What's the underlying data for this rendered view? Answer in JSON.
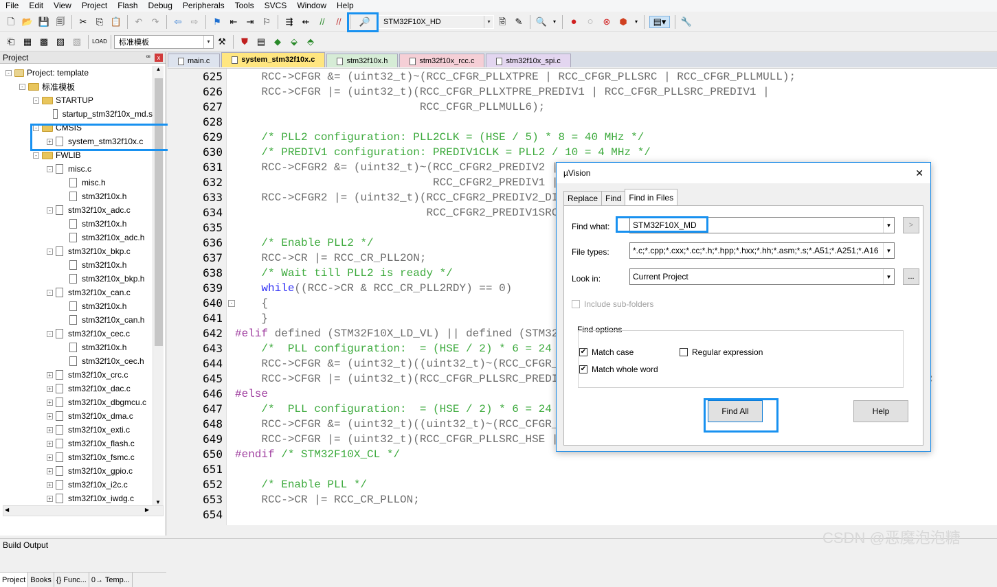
{
  "menu": [
    "File",
    "Edit",
    "View",
    "Project",
    "Flash",
    "Debug",
    "Peripherals",
    "Tools",
    "SVCS",
    "Window",
    "Help"
  ],
  "toolbar": {
    "target_combo": "STM32F10X_HD",
    "template_combo": "标准模板"
  },
  "project_panel": {
    "title": "Project",
    "close_glyph": "x",
    "pin_glyph": "ꟹ",
    "root": "Project: template",
    "tree": [
      {
        "label": "标准模板",
        "level": 1,
        "kind": "folder",
        "exp": "-"
      },
      {
        "label": "STARTUP",
        "level": 2,
        "kind": "folder",
        "exp": "-"
      },
      {
        "label": "startup_stm32f10x_md.s",
        "level": 3,
        "kind": "file",
        "exp": ""
      },
      {
        "label": "CMSIS",
        "level": 2,
        "kind": "folder",
        "exp": "-"
      },
      {
        "label": "system_stm32f10x.c",
        "level": 3,
        "kind": "file",
        "exp": "+"
      },
      {
        "label": "FWLIB",
        "level": 2,
        "kind": "folder",
        "exp": "-"
      },
      {
        "label": "misc.c",
        "level": 3,
        "kind": "file",
        "exp": "-"
      },
      {
        "label": "misc.h",
        "level": 4,
        "kind": "file",
        "exp": ""
      },
      {
        "label": "stm32f10x.h",
        "level": 4,
        "kind": "file",
        "exp": ""
      },
      {
        "label": "stm32f10x_adc.c",
        "level": 3,
        "kind": "file",
        "exp": "-"
      },
      {
        "label": "stm32f10x.h",
        "level": 4,
        "kind": "file",
        "exp": ""
      },
      {
        "label": "stm32f10x_adc.h",
        "level": 4,
        "kind": "file",
        "exp": ""
      },
      {
        "label": "stm32f10x_bkp.c",
        "level": 3,
        "kind": "file",
        "exp": "-"
      },
      {
        "label": "stm32f10x.h",
        "level": 4,
        "kind": "file",
        "exp": ""
      },
      {
        "label": "stm32f10x_bkp.h",
        "level": 4,
        "kind": "file",
        "exp": ""
      },
      {
        "label": "stm32f10x_can.c",
        "level": 3,
        "kind": "file",
        "exp": "-"
      },
      {
        "label": "stm32f10x.h",
        "level": 4,
        "kind": "file",
        "exp": ""
      },
      {
        "label": "stm32f10x_can.h",
        "level": 4,
        "kind": "file",
        "exp": ""
      },
      {
        "label": "stm32f10x_cec.c",
        "level": 3,
        "kind": "file",
        "exp": "-"
      },
      {
        "label": "stm32f10x.h",
        "level": 4,
        "kind": "file",
        "exp": ""
      },
      {
        "label": "stm32f10x_cec.h",
        "level": 4,
        "kind": "file",
        "exp": ""
      },
      {
        "label": "stm32f10x_crc.c",
        "level": 3,
        "kind": "file",
        "exp": "+"
      },
      {
        "label": "stm32f10x_dac.c",
        "level": 3,
        "kind": "file",
        "exp": "+"
      },
      {
        "label": "stm32f10x_dbgmcu.c",
        "level": 3,
        "kind": "file",
        "exp": "+"
      },
      {
        "label": "stm32f10x_dma.c",
        "level": 3,
        "kind": "file",
        "exp": "+"
      },
      {
        "label": "stm32f10x_exti.c",
        "level": 3,
        "kind": "file",
        "exp": "+"
      },
      {
        "label": "stm32f10x_flash.c",
        "level": 3,
        "kind": "file",
        "exp": "+"
      },
      {
        "label": "stm32f10x_fsmc.c",
        "level": 3,
        "kind": "file",
        "exp": "+"
      },
      {
        "label": "stm32f10x_gpio.c",
        "level": 3,
        "kind": "file",
        "exp": "+"
      },
      {
        "label": "stm32f10x_i2c.c",
        "level": 3,
        "kind": "file",
        "exp": "+"
      },
      {
        "label": "stm32f10x_iwdg.c",
        "level": 3,
        "kind": "file",
        "exp": "+"
      }
    ],
    "bottom_tabs": [
      "Project",
      "Books",
      "{} Func...",
      "0→ Temp..."
    ]
  },
  "editor_tabs": [
    {
      "label": "main.c",
      "color": "#dde3ee",
      "active": false
    },
    {
      "label": "system_stm32f10x.c",
      "color": "#ffe680",
      "active": true
    },
    {
      "label": "stm32f10x.h",
      "color": "#d6ecd6",
      "active": false
    },
    {
      "label": "stm32f10x_rcc.c",
      "color": "#f5cfd6",
      "active": false
    },
    {
      "label": "stm32f10x_spi.c",
      "color": "#e3d6f0",
      "active": false
    }
  ],
  "code": {
    "lines": [
      {
        "n": "625",
        "fold": "",
        "html": "    RCC->CFGR &amp;= (uint32_t)~(RCC_CFGR_PLLXTPRE | RCC_CFGR_PLLSRC | RCC_CFGR_PLLMULL);"
      },
      {
        "n": "626",
        "fold": "",
        "html": "    RCC->CFGR |= (uint32_t)(RCC_CFGR_PLLXTPRE_PREDIV1 | RCC_CFGR_PLLSRC_PREDIV1 |"
      },
      {
        "n": "627",
        "fold": "",
        "html": "                            RCC_CFGR_PLLMULL6);"
      },
      {
        "n": "628",
        "fold": "",
        "html": ""
      },
      {
        "n": "629",
        "fold": "",
        "html": "    <span class='cm'>/* PLL2 configuration: PLL2CLK = (HSE / 5) * 8 = 40 MHz */</span>"
      },
      {
        "n": "630",
        "fold": "",
        "html": "    <span class='cm'>/* PREDIV1 configuration: PREDIV1CLK = PLL2 / 10 = 4 MHz */</span>"
      },
      {
        "n": "631",
        "fold": "",
        "html": "    RCC->CFGR2 &amp;= (uint32_t)~(RCC_CFGR2_PREDIV2 | RCC_CFGR2_PLL2MUL |"
      },
      {
        "n": "632",
        "fold": "",
        "html": "                              RCC_CFGR2_PREDIV1 | RCC_CFGR2_PREDIV1SRC);"
      },
      {
        "n": "633",
        "fold": "",
        "html": "    RCC->CFGR2 |= (uint32_t)(RCC_CFGR2_PREDIV2_DIV5 | RCC_CFGR2_PLL2MUL8 |"
      },
      {
        "n": "634",
        "fold": "",
        "html": "                             RCC_CFGR2_PREDIV1SRC_PLL2 | RCC_CFGR2_PREDIV1_DIV10);"
      },
      {
        "n": "635",
        "fold": "",
        "html": ""
      },
      {
        "n": "636",
        "fold": "",
        "html": "    <span class='cm'>/* Enable PLL2 */</span>"
      },
      {
        "n": "637",
        "fold": "",
        "html": "    RCC->CR |= RCC_CR_PLL2ON;"
      },
      {
        "n": "638",
        "fold": "",
        "html": "    <span class='cm'>/* Wait till PLL2 is ready */</span>"
      },
      {
        "n": "639",
        "fold": "",
        "html": "    <span class='kw'>while</span>((RCC->CR &amp; RCC_CR_PLL2RDY) == 0)"
      },
      {
        "n": "640",
        "fold": "-",
        "html": "    {"
      },
      {
        "n": "641",
        "fold": "",
        "html": "    }"
      },
      {
        "n": "642",
        "fold": "",
        "html": "<span class='pp'>#elif</span> defined (STM32F10X_LD_VL) || defined (STM32F10X_MD_VL) || defined (STM32F10X_HD_VL)"
      },
      {
        "n": "643",
        "fold": "",
        "html": "    <span class='cm'>/*  PLL configuration:  = (HSE / 2) * 6 = 24 MHz */</span>"
      },
      {
        "n": "644",
        "fold": "",
        "html": "    RCC->CFGR &amp;= (uint32_t)((uint32_t)~(RCC_CFGR_PLLSRC | RCC_CFGR_PLLXTPRE | RCC_CFGR_PLLMULL));"
      },
      {
        "n": "645",
        "fold": "",
        "html": "    RCC->CFGR |= (uint32_t)(RCC_CFGR_PLLSRC_PREDIV1 | RCC_CFGR_PLLXTPRE_PREDIV1_Div2 | RCC_CFGR_PLLMULL6);"
      },
      {
        "n": "646",
        "fold": "",
        "html": "<span class='pp'>#else</span>"
      },
      {
        "n": "647",
        "fold": "",
        "html": "    <span class='cm'>/*  PLL configuration:  = (HSE / 2) * 6 = 24 MHz */</span>"
      },
      {
        "n": "648",
        "fold": "",
        "html": "    RCC->CFGR &amp;= (uint32_t)((uint32_t)~(RCC_CFGR_PLLSRC | RCC_CFGR_PLLXTPRE | RCC_CFGR_PLLMULL));"
      },
      {
        "n": "649",
        "fold": "",
        "html": "    RCC->CFGR |= (uint32_t)(RCC_CFGR_PLLSRC_HSE | RCC_CFGR_PLLXTPRE_HSE_Div2 | RCC_CFGR_PLLMULL6);"
      },
      {
        "n": "650",
        "fold": "",
        "html": "<span class='pp'>#endif</span> <span class='cm'>/* STM32F10X_CL */</span>"
      },
      {
        "n": "651",
        "fold": "",
        "html": ""
      },
      {
        "n": "652",
        "fold": "",
        "html": "    <span class='cm'>/* Enable PLL */</span>"
      },
      {
        "n": "653",
        "fold": "",
        "html": "    RCC->CR |= RCC_CR_PLLON;"
      },
      {
        "n": "654",
        "fold": "",
        "html": ""
      }
    ]
  },
  "dialog": {
    "title": "µVision",
    "close": "✕",
    "tabs": [
      "Replace",
      "Find",
      "Find in Files"
    ],
    "find_what_label": "Find what:",
    "find_what_value": "STM32F10X_MD",
    "file_types_label": "File types:",
    "file_types_value": "*.c;*.cpp;*.cxx;*.cc;*.h;*.hpp;*.hxx;*.hh;*.asm;*.s;*.A51;*.A251;*.A16",
    "look_in_label": "Look in:",
    "look_in_value": "Current Project",
    "browse": "...",
    "small_btn": ">",
    "include_sub": "Include sub-folders",
    "find_options_label": "Find options",
    "match_case": "Match case",
    "match_whole_word": "Match whole word",
    "regex": "Regular expression",
    "check_mark": "✔",
    "find_all": "Find All",
    "help": "Help"
  },
  "build_output": "Build Output",
  "watermark": "CSDN @恶魔泡泡糖"
}
